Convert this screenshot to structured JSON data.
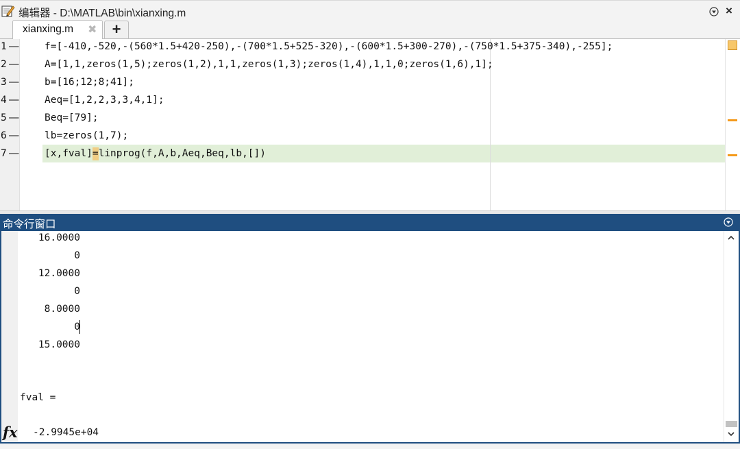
{
  "editor": {
    "title": "编辑器 - D:\\MATLAB\\bin\\xianxing.m",
    "tab_label": "xianxing.m",
    "tab_close_glyph": "✖",
    "tab_add_glyph": "+",
    "close_glyph": "×",
    "line_numbers": [
      "1",
      "2",
      "3",
      "4",
      "5",
      "6",
      "7"
    ],
    "line_marker": "—",
    "lines": [
      "f=[-410,-520,-(560*1.5+420-250),-(700*1.5+525-320),-(600*1.5+300-270),-(750*1.5+375-340),-255];",
      "A=[1,1,zeros(1,5);zeros(1,2),1,1,zeros(1,3);zeros(1,4),1,1,0;zeros(1,6),1];",
      "b=[16;12;8;41];",
      "Aeq=[1,2,2,3,3,4,1];",
      "Beq=[79];",
      "lb=zeros(1,7);",
      "[x,fval]=linprog(f,A,b,Aeq,Beq,lb,[])"
    ],
    "highlight_color": "#e1efd8",
    "warning_color": "#f49a1c"
  },
  "command_window": {
    "title": "命令行窗口",
    "x_values": [
      "16.0000",
      "0",
      "12.0000",
      "0",
      "8.0000",
      "0",
      "15.0000"
    ],
    "fval_label": "fval =",
    "fval_value": "-2.9945e+04",
    "prompt_icon": "fx",
    "title_bg": "#1f4e80"
  }
}
